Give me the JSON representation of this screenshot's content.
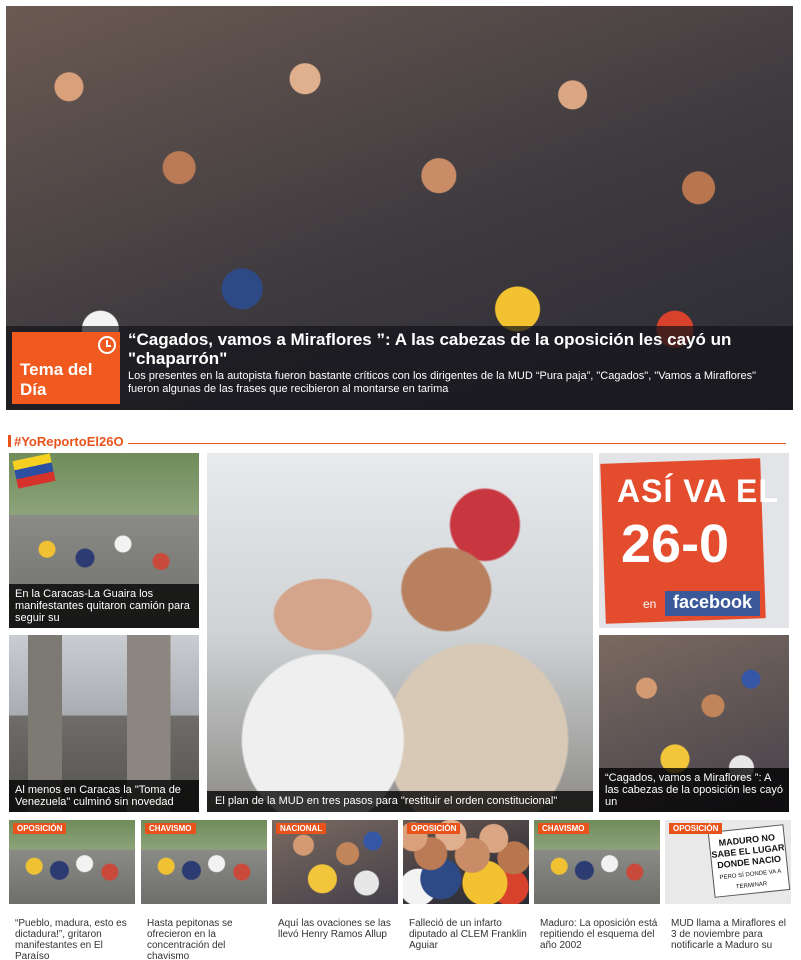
{
  "hero": {
    "tag": "Tema del Día",
    "title": "“Cagados, vamos a Miraflores ”: A las cabezas de la oposición les cayó un \"chaparrón\"",
    "summary": "Los presentes en la autopista fueron bastante críticos con los dirigentes de la MUD “Pura paja”, \"Cagados\", \"Vamos a Miraflores\" fueron algunas de las frases que recibieron al montarse en tarima"
  },
  "section": {
    "title": "#YoReportoEl26O"
  },
  "cards": {
    "left_top": "En la Caracas-La Guaira los manifestantes quitaron camión para seguir su",
    "left_bottom": "Al menos en Caracas la \"Toma de Venezuela\" culminó sin novedad",
    "center": "El plan de la MUD en tres pasos para \"restituir el orden constitucional\"",
    "right_bottom": "“Cagados, vamos a Miraflores ”: A las cabezas de la oposición les cayó un"
  },
  "ad": {
    "line1": "ASÍ VA EL",
    "line2": "26-0",
    "en": "en",
    "brand": "facebook"
  },
  "bottom": [
    {
      "badge": "OPOSICIÓN",
      "title": "“Pueblo, madura, esto es dictadura!”, gritaron manifestantes en El Paraíso"
    },
    {
      "badge": "CHAVISMO",
      "title": "Hasta pepitonas se ofrecieron en la concentración del chavismo"
    },
    {
      "badge": "NACIONAL",
      "title": "Aquí las ovaciones se las llevó Henry Ramos Allup"
    },
    {
      "badge": "OPOSICIÓN",
      "title": "Falleció de un infarto diputado al CLEM Franklin Aguiar"
    },
    {
      "badge": "CHAVISMO",
      "title": "Maduro: La oposición está repitiendo el esquema del año 2002"
    },
    {
      "badge": "OPOSICIÓN",
      "title": "MUD llama a Miraflores el 3 de noviembre para notificarle a Maduro su"
    }
  ],
  "sign": {
    "text": "MADURO NO SABE EL LUGAR DONDE NACIO",
    "sub": "PERO SÍ DONDE VA A TERMINAR"
  },
  "colors": {
    "accent": "#e8531c",
    "tema_bg": "#f15a1e",
    "facebook": "#3b5998"
  }
}
